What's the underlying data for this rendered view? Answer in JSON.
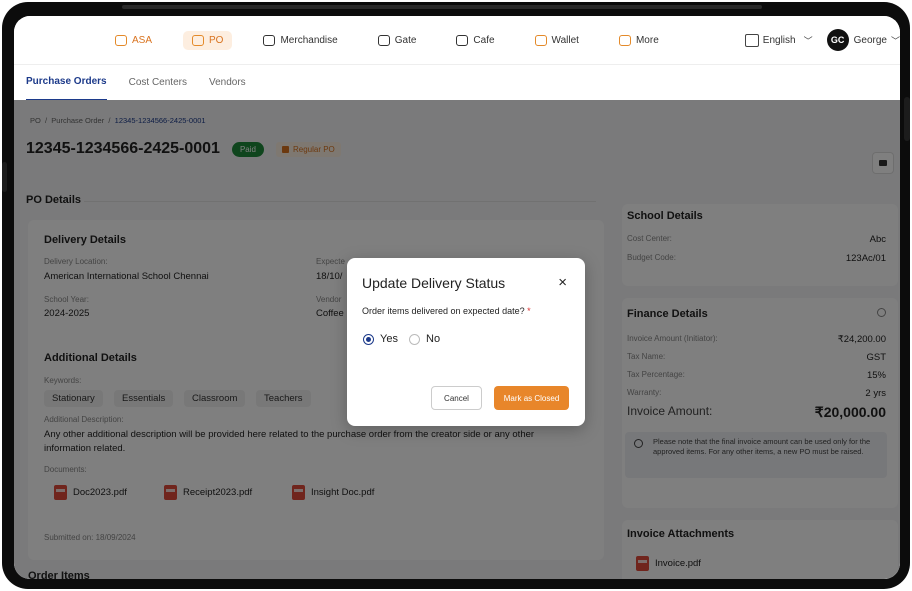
{
  "nav": {
    "items": [
      {
        "label": "ASA"
      },
      {
        "label": "PO"
      },
      {
        "label": "Merchandise"
      },
      {
        "label": "Gate"
      },
      {
        "label": "Cafe"
      },
      {
        "label": "Wallet"
      },
      {
        "label": "More"
      }
    ],
    "language": "English",
    "avatar_initials": "GC",
    "user_name": "George"
  },
  "subnav": {
    "tabs": [
      {
        "label": "Purchase Orders"
      },
      {
        "label": "Cost Centers"
      },
      {
        "label": "Vendors"
      }
    ]
  },
  "breadcrumb": {
    "root": "PO",
    "mid": "Purchase Order",
    "current": "12345-1234566-2425-0001",
    "sep": "/"
  },
  "po": {
    "number": "12345-1234566-2425-0001",
    "status": "Paid",
    "type": "Regular PO"
  },
  "po_details": {
    "section_title": "PO Details",
    "delivery": {
      "title": "Delivery Details",
      "location_label": "Delivery Location:",
      "location_value": "American International School Chennai",
      "expected_label": "Expecte",
      "expected_value": "18/10/",
      "school_year_label": "School Year:",
      "school_year_value": "2024-2025",
      "vendor_label": "Vendor",
      "vendor_value": "Coffee"
    },
    "additional": {
      "title": "Additional Details",
      "keywords_label": "Keywords:",
      "keywords": [
        "Stationary",
        "Essentials",
        "Classroom",
        "Teachers"
      ],
      "desc_label": "Additional Description:",
      "desc_line1": "Any other additional description will be provided here related to the purchase order from the creator side or any other",
      "desc_line2": "information  related.",
      "docs_label": "Documents:",
      "docs": [
        "Doc2023.pdf",
        "Receipt2023.pdf",
        "Insight Doc.pdf"
      ],
      "submitted": "Submitted on: 18/09/2024"
    },
    "order_items_title": "Order Items"
  },
  "school": {
    "title": "School Details",
    "cost_center_label": "Cost Center:",
    "cost_center_value": "Abc",
    "budget_label": "Budget Code:",
    "budget_value": "123Ac/01"
  },
  "finance": {
    "title": "Finance Details",
    "rows": [
      {
        "label": "Invoice Amount (Initiator):",
        "value": "₹24,200.00"
      },
      {
        "label": "Tax Name:",
        "value": "GST"
      },
      {
        "label": "Tax Percentage:",
        "value": "15%"
      },
      {
        "label": "Warranty:",
        "value": "2 yrs"
      }
    ],
    "invoice_label": "Invoice Amount:",
    "invoice_value": "₹20,000.00",
    "notice": "Please note that the final invoice amount can be used only for the approved items. For any other items, a new PO must be raised."
  },
  "attachments": {
    "title": "Invoice Attachments",
    "file": "Invoice.pdf"
  },
  "modal": {
    "title": "Update Delivery Status",
    "close": "×",
    "question": "Order items delivered on expected date?",
    "required": "*",
    "options": [
      "Yes",
      "No"
    ],
    "selected": "Yes",
    "cancel": "Cancel",
    "confirm": "Mark as Closed"
  },
  "colors": {
    "accent": "#e8862a",
    "primary": "#1c3a8a",
    "paid": "#1e8a3a"
  }
}
